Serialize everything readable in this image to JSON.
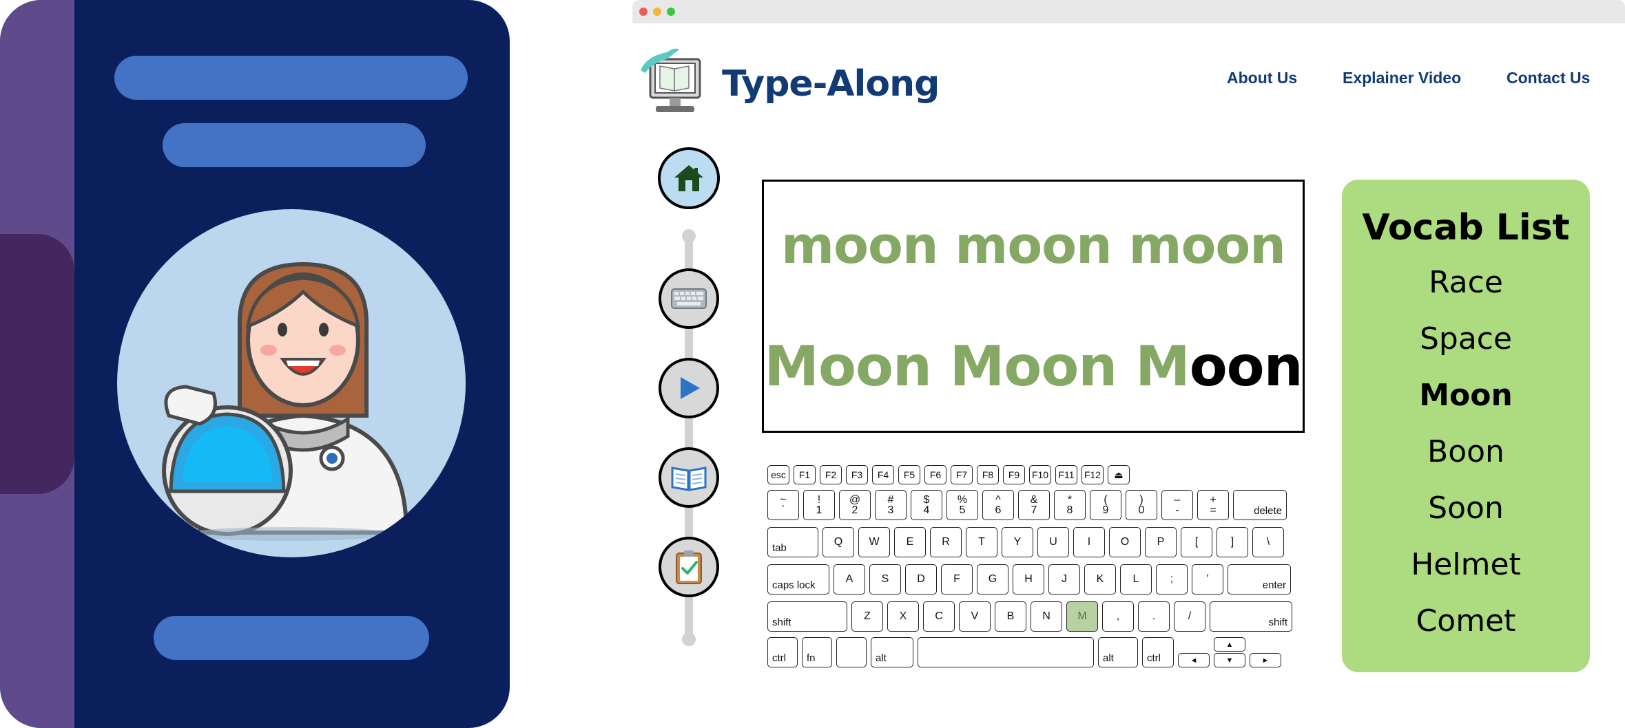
{
  "colors": {
    "book_cover": "#0a1f5c",
    "book_spine": "#5f4a8b",
    "book_bar": "#4472c4",
    "brand_blue": "#123a75",
    "typed_green": "#85a865",
    "vocab_panel": "#addb7f",
    "active_key": "#b8d1a3"
  },
  "header": {
    "brand": "Type-Along",
    "nav": [
      "About Us",
      "Explainer Video",
      "Contact Us"
    ]
  },
  "sidebar": {
    "steps": [
      {
        "name": "home",
        "icon": "house-icon"
      },
      {
        "name": "keyboard",
        "icon": "keyboard-icon"
      },
      {
        "name": "play",
        "icon": "play-icon"
      },
      {
        "name": "book",
        "icon": "open-book-icon"
      },
      {
        "name": "clipboard",
        "icon": "clipboard-check-icon"
      }
    ]
  },
  "exercise": {
    "prompt": "moon moon moon",
    "typed": "Moon Moon M",
    "remaining": "oon"
  },
  "keyboard": {
    "fn_row": [
      "esc",
      "F1",
      "F2",
      "F3",
      "F4",
      "F5",
      "F6",
      "F7",
      "F8",
      "F9",
      "F10",
      "F11",
      "F12",
      "⏏"
    ],
    "number_row": [
      [
        "~",
        "`"
      ],
      [
        "!",
        "1"
      ],
      [
        "@",
        "2"
      ],
      [
        "#",
        "3"
      ],
      [
        "$",
        "4"
      ],
      [
        "%",
        "5"
      ],
      [
        "^",
        "6"
      ],
      [
        "&",
        "7"
      ],
      [
        "*",
        "8"
      ],
      [
        "(",
        "9"
      ],
      [
        ")",
        "0"
      ],
      [
        "–",
        "-"
      ],
      [
        "+",
        "="
      ]
    ],
    "delete_label": "delete",
    "tab_label": "tab",
    "qwerty_row": [
      "Q",
      "W",
      "E",
      "R",
      "T",
      "Y",
      "U",
      "I",
      "O",
      "P",
      "[",
      "]",
      "\\"
    ],
    "caps_label": "caps lock",
    "home_row": [
      "A",
      "S",
      "D",
      "F",
      "G",
      "H",
      "J",
      "K",
      "L",
      ";",
      "'"
    ],
    "enter_label": "enter",
    "shift_label": "shift",
    "bottom_letters": [
      "Z",
      "X",
      "C",
      "V",
      "B",
      "N",
      "M",
      ",",
      ".",
      "/"
    ],
    "active_key": "M",
    "ctrl_label": "ctrl",
    "fn_label": "fn",
    "alt_label": "alt",
    "arrows": {
      "left": "◄",
      "up": "▲",
      "down": "▼",
      "right": "►"
    }
  },
  "vocab": {
    "title": "Vocab List",
    "items": [
      "Race",
      "Space",
      "Moon",
      "Boon",
      "Soon",
      "Helmet",
      "Comet"
    ],
    "current": "Moon"
  }
}
